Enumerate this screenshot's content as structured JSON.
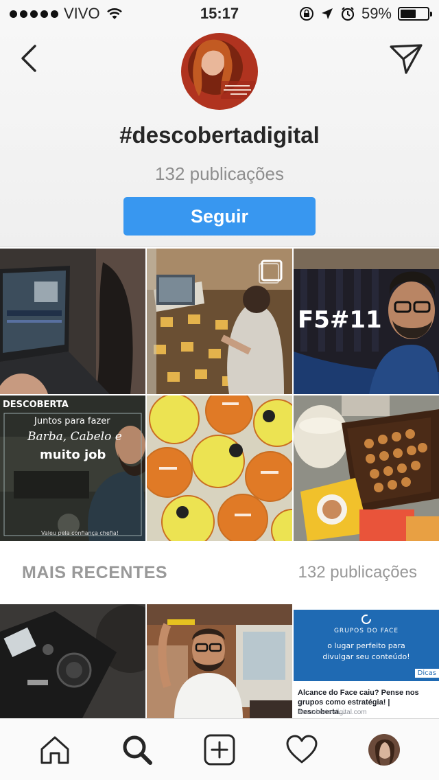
{
  "status_bar": {
    "carrier": "VIVO",
    "time": "15:17",
    "battery_percent": "59%",
    "battery_level": 0.59
  },
  "header": {
    "hashtag": "#descobertadigital",
    "post_count": "132 publicações",
    "follow_label": "Seguir"
  },
  "top_posts": [
    {
      "name": "post-laptop-editing"
    },
    {
      "name": "post-video-recording",
      "multi": true
    },
    {
      "name": "post-f5-11",
      "text": "F5#11"
    },
    {
      "name": "post-barba-cabelo",
      "brand": "DESCOBERTA",
      "line1": "Juntos para fazer",
      "line2": "Barba, Cabelo e",
      "line3": "muito job",
      "caption": "Valeu pela confiança chefia!"
    },
    {
      "name": "post-coasters"
    },
    {
      "name": "post-cookies"
    }
  ],
  "recent_section": {
    "title": "MAIS RECENTES",
    "count": "132 publicações"
  },
  "recent_posts": [
    {
      "name": "post-camera"
    },
    {
      "name": "post-man-laughing"
    },
    {
      "name": "post-link-preview",
      "banner_title": "GRUPOS DO FACE",
      "banner_text_1": "o lugar perfeito para",
      "banner_text_2": "divulgar seu conteúdo!",
      "badge": "Dicas",
      "headline": "Alcance do Face caiu? Pense nos grupos como estratégia! | Descoberta...",
      "domain": "descoberta-digital.com"
    }
  ],
  "tab_bar": {
    "items": [
      "home-icon",
      "search-icon",
      "add-post-icon",
      "heart-icon",
      "profile-avatar"
    ],
    "active": "search-icon"
  },
  "colors": {
    "accent": "#3897f0",
    "muted": "#8e8e8e"
  }
}
